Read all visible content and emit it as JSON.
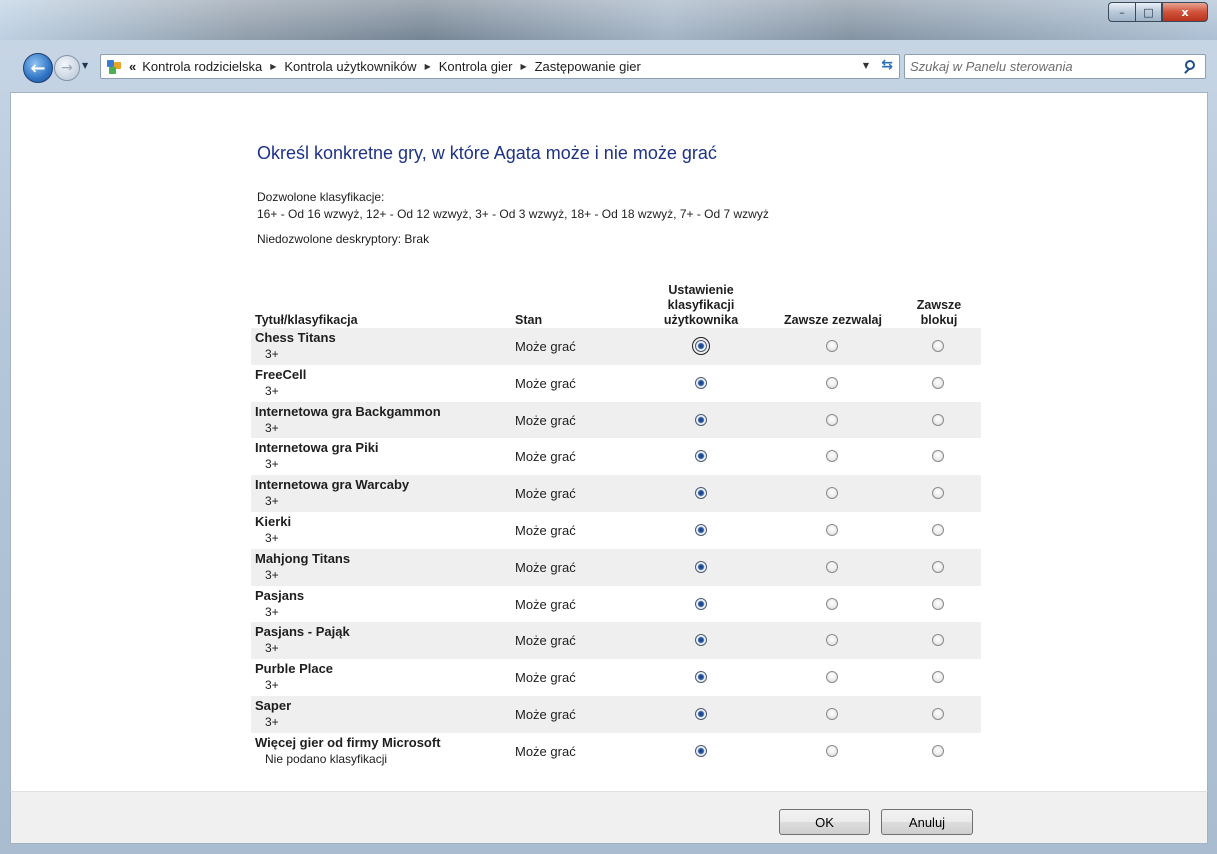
{
  "window": {
    "caption_min": "–",
    "caption_max": "□",
    "caption_close": "x"
  },
  "nav": {
    "back_icon": "arrow-left-icon",
    "forward_icon": "arrow-right-icon",
    "overflow": "«",
    "breadcrumbs": [
      "Kontrola rodzicielska",
      "Kontrola użytkowników",
      "Kontrola gier",
      "Zastępowanie gier"
    ],
    "search_placeholder": "Szukaj w Panelu sterowania"
  },
  "page": {
    "title": "Określ konkretne gry, w które Agata może i nie może grać",
    "allowed_label": "Dozwolone klasyfikacje:",
    "allowed_values": "16+ - Od 16 wzwyż, 12+ - Od 12 wzwyż, 3+ - Od 3 wzwyż, 18+ - Od 18 wzwyż, 7+ - Od 7 wzwyż",
    "disallowed_label": "Niedozwolone deskryptory:  Brak"
  },
  "table": {
    "headers": {
      "title": "Tytuł/klasyfikacja",
      "status": "Stan",
      "user_setting_1": "Ustawienie",
      "user_setting_2": "klasyfikacji",
      "user_setting_3": "użytkownika",
      "always_allow": "Zawsze zezwalaj",
      "always_block_1": "Zawsze",
      "always_block_2": "blokuj"
    },
    "rows": [
      {
        "title": "Chess Titans",
        "rating": "3+",
        "status": "Może grać",
        "selected": "user"
      },
      {
        "title": "FreeCell",
        "rating": "3+",
        "status": "Może grać",
        "selected": "user"
      },
      {
        "title": "Internetowa gra Backgammon",
        "rating": "3+",
        "status": "Może grać",
        "selected": "user"
      },
      {
        "title": "Internetowa gra Piki",
        "rating": "3+",
        "status": "Może grać",
        "selected": "user"
      },
      {
        "title": "Internetowa gra Warcaby",
        "rating": "3+",
        "status": "Może grać",
        "selected": "user"
      },
      {
        "title": "Kierki",
        "rating": "3+",
        "status": "Może grać",
        "selected": "user"
      },
      {
        "title": "Mahjong Titans",
        "rating": "3+",
        "status": "Może grać",
        "selected": "user"
      },
      {
        "title": "Pasjans",
        "rating": "3+",
        "status": "Może grać",
        "selected": "user"
      },
      {
        "title": "Pasjans - Pająk",
        "rating": "3+",
        "status": "Może grać",
        "selected": "user"
      },
      {
        "title": "Purble Place",
        "rating": "3+",
        "status": "Może grać",
        "selected": "user"
      },
      {
        "title": "Saper",
        "rating": "3+",
        "status": "Może grać",
        "selected": "user"
      },
      {
        "title": "Więcej gier od firmy Microsoft",
        "rating": "Nie podano klasyfikacji",
        "status": "Może grać",
        "selected": "user"
      }
    ]
  },
  "footer": {
    "ok_label": "OK",
    "cancel_label": "Anuluj"
  },
  "colors": {
    "title_blue": "#1e3287",
    "alt_row": "#efefef",
    "close_button": "#c7432b"
  }
}
